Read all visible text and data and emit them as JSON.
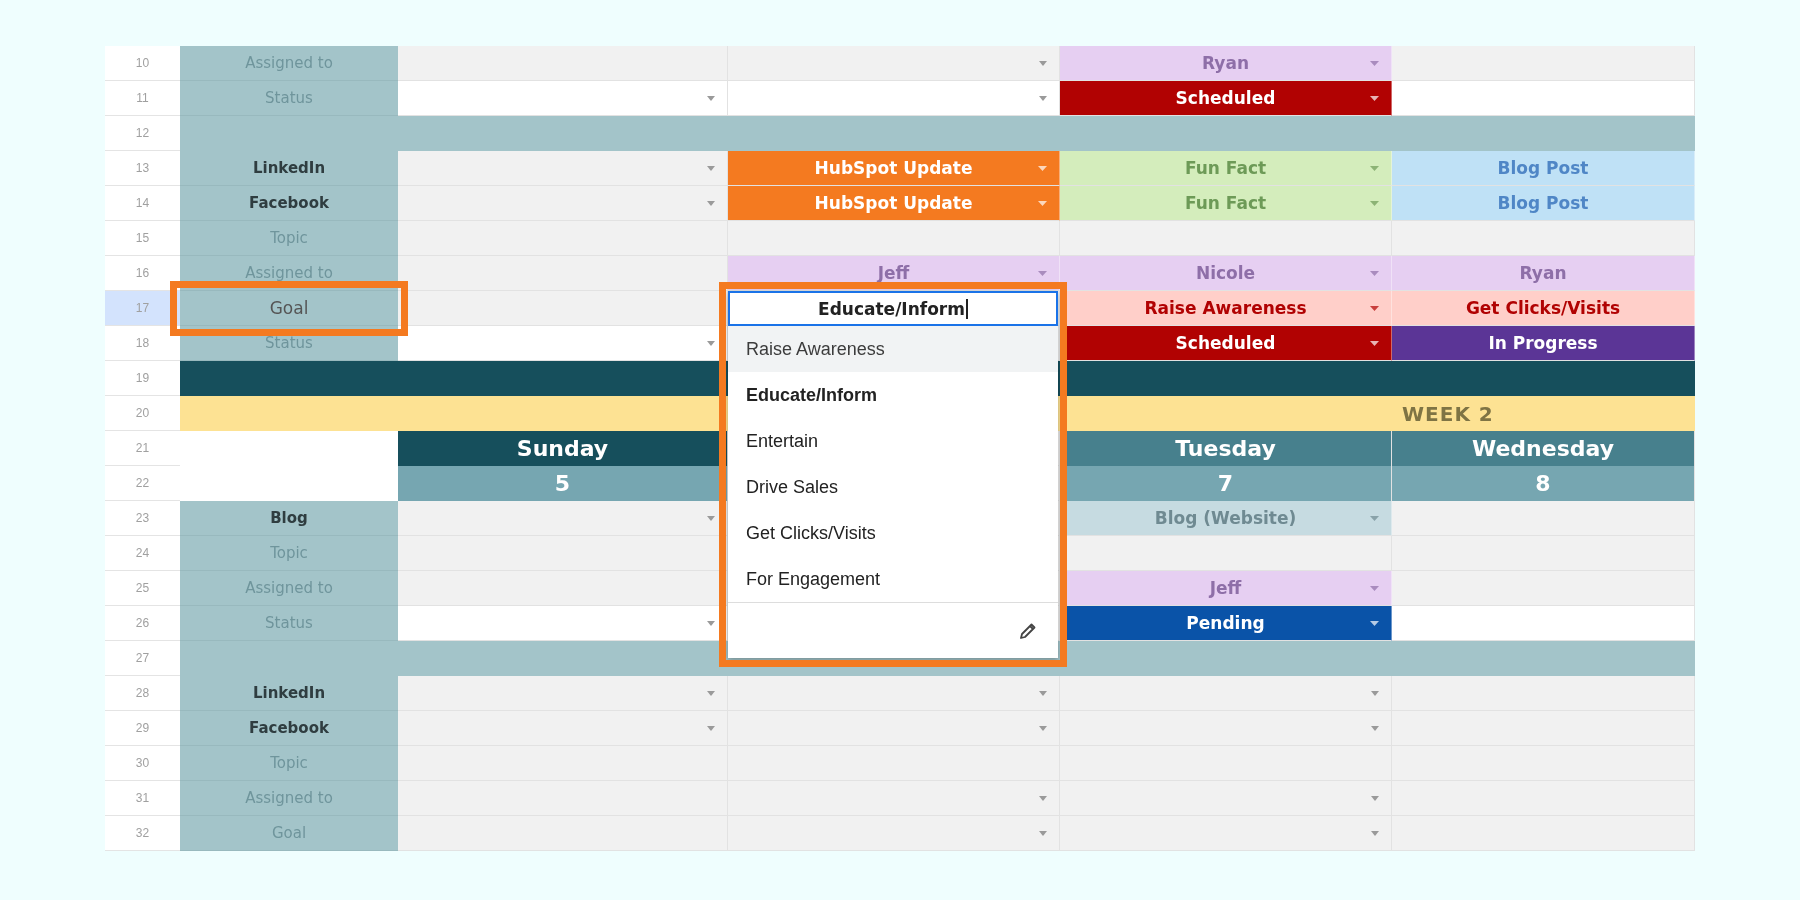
{
  "rows": [
    {
      "number": "10",
      "kind": "entry",
      "label": {
        "text": "Assigned to",
        "kind": "field"
      },
      "selected": false,
      "cells": [
        {
          "kind": "grey",
          "caret": false
        },
        {
          "kind": "grey",
          "caret": true
        },
        {
          "kind": "chip",
          "caret": true,
          "color": "#e6cff2",
          "label": {
            "text": "Ryan",
            "color": "#8e6fa8"
          }
        },
        {
          "kind": "grey",
          "caret": false
        }
      ]
    },
    {
      "number": "11",
      "kind": "entry",
      "label": {
        "text": "Status",
        "kind": "field"
      },
      "selected": false,
      "cells": [
        {
          "kind": "white",
          "caret": true
        },
        {
          "kind": "white",
          "caret": true
        },
        {
          "kind": "chip",
          "caret": true,
          "color": "#b10202",
          "label": {
            "text": "Scheduled",
            "color": "#ffffff"
          }
        },
        {
          "kind": "white",
          "caret": false
        }
      ]
    },
    {
      "number": "12",
      "kind": "divider"
    },
    {
      "number": "13",
      "kind": "entry",
      "label": {
        "text": "LinkedIn",
        "kind": "platform"
      },
      "selected": false,
      "cells": [
        {
          "kind": "grey",
          "caret": true
        },
        {
          "kind": "chip",
          "caret": true,
          "color": "#f47a20",
          "label": {
            "text": "HubSpot Update",
            "color": "#ffffff"
          }
        },
        {
          "kind": "chip",
          "caret": true,
          "color": "#d4edbc",
          "label": {
            "text": "Fun Fact",
            "color": "#6d9a57"
          }
        },
        {
          "kind": "chip",
          "caret": false,
          "color": "#bfe1f6",
          "label": {
            "text": "Blog Post",
            "color": "#4f86c6"
          }
        }
      ]
    },
    {
      "number": "14",
      "kind": "entry",
      "label": {
        "text": "Facebook",
        "kind": "platform"
      },
      "selected": false,
      "cells": [
        {
          "kind": "grey",
          "caret": true
        },
        {
          "kind": "chip",
          "caret": true,
          "color": "#f47a20",
          "label": {
            "text": "HubSpot Update",
            "color": "#ffffff"
          }
        },
        {
          "kind": "chip",
          "caret": true,
          "color": "#d4edbc",
          "label": {
            "text": "Fun Fact",
            "color": "#6d9a57"
          }
        },
        {
          "kind": "chip",
          "caret": false,
          "color": "#bfe1f6",
          "label": {
            "text": "Blog Post",
            "color": "#4f86c6"
          }
        }
      ]
    },
    {
      "number": "15",
      "kind": "entry",
      "label": {
        "text": "Topic",
        "kind": "field"
      },
      "selected": false,
      "cells": [
        {
          "kind": "grey",
          "caret": false
        },
        {
          "kind": "grey",
          "caret": false
        },
        {
          "kind": "grey",
          "caret": false
        },
        {
          "kind": "grey",
          "caret": false
        }
      ]
    },
    {
      "number": "16",
      "kind": "entry",
      "label": {
        "text": "Assigned to",
        "kind": "field"
      },
      "selected": false,
      "cells": [
        {
          "kind": "grey",
          "caret": false
        },
        {
          "kind": "chip",
          "caret": true,
          "color": "#e6cff2",
          "label": {
            "text": "Jeff",
            "color": "#8e6fa8"
          }
        },
        {
          "kind": "chip",
          "caret": true,
          "color": "#e6cff2",
          "label": {
            "text": "Nicole",
            "color": "#8e6fa8"
          }
        },
        {
          "kind": "chip",
          "caret": false,
          "color": "#e6cff2",
          "label": {
            "text": "Ryan",
            "color": "#8e6fa8"
          }
        }
      ]
    },
    {
      "number": "17",
      "kind": "entry",
      "label": {
        "text": "Goal",
        "kind": "field"
      },
      "selected": true,
      "cells": [
        {
          "kind": "grey",
          "caret": false
        },
        {
          "kind": "dropdown"
        },
        {
          "kind": "chip",
          "caret": true,
          "color": "#ffcfc9",
          "label": {
            "text": "Raise Awareness",
            "color": "#b10202"
          }
        },
        {
          "kind": "chip",
          "caret": false,
          "color": "#ffcfc9",
          "label": {
            "text": "Get Clicks/Visits",
            "color": "#b10202"
          }
        }
      ]
    },
    {
      "number": "18",
      "kind": "entry",
      "label": {
        "text": "Status",
        "kind": "field"
      },
      "selected": false,
      "cells": [
        {
          "kind": "white",
          "caret": true
        },
        {
          "kind": "covered"
        },
        {
          "kind": "chip",
          "caret": true,
          "color": "#b10202",
          "label": {
            "text": "Scheduled",
            "color": "#ffffff"
          }
        },
        {
          "kind": "chip",
          "caret": false,
          "color": "#5b3596",
          "label": {
            "text": "In Progress",
            "color": "#ffffff"
          }
        }
      ]
    },
    {
      "number": "19",
      "kind": "week_start"
    },
    {
      "number": "20",
      "kind": "week",
      "text": "WEEK 2"
    },
    {
      "number": "21",
      "kind": "day",
      "cells": [
        {
          "kind": "head",
          "text": "Sunday",
          "color": "#164f5c"
        },
        {
          "kind": "covered"
        },
        {
          "kind": "head",
          "text": "Tuesday",
          "color": "#47808d"
        },
        {
          "kind": "head",
          "text": "Wednesday",
          "color": "#47808d"
        }
      ]
    },
    {
      "number": "22",
      "kind": "day",
      "cells": [
        {
          "kind": "head",
          "text": "5",
          "color": "#76a6b1"
        },
        {
          "kind": "covered"
        },
        {
          "kind": "head",
          "text": "7",
          "color": "#76a6b1"
        },
        {
          "kind": "head",
          "text": "8",
          "color": "#76a6b1"
        }
      ]
    },
    {
      "number": "23",
      "kind": "entry",
      "label": {
        "text": "Blog",
        "kind": "platform"
      },
      "selected": false,
      "cells": [
        {
          "kind": "grey",
          "caret": true
        },
        {
          "kind": "covered"
        },
        {
          "kind": "chip",
          "caret": true,
          "color": "#c6dbe1",
          "label": {
            "text": "Blog (Website)",
            "color": "#6f8a92"
          }
        },
        {
          "kind": "grey",
          "caret": false
        }
      ]
    },
    {
      "number": "24",
      "kind": "entry",
      "label": {
        "text": "Topic",
        "kind": "field"
      },
      "selected": false,
      "cells": [
        {
          "kind": "grey",
          "caret": false
        },
        {
          "kind": "covered"
        },
        {
          "kind": "grey",
          "caret": false
        },
        {
          "kind": "grey",
          "caret": false
        }
      ]
    },
    {
      "number": "25",
      "kind": "entry",
      "label": {
        "text": "Assigned to",
        "kind": "field"
      },
      "selected": false,
      "cells": [
        {
          "kind": "grey",
          "caret": false
        },
        {
          "kind": "covered"
        },
        {
          "kind": "chip",
          "caret": true,
          "color": "#e6cff2",
          "label": {
            "text": "Jeff",
            "color": "#8e6fa8"
          }
        },
        {
          "kind": "grey",
          "caret": false
        }
      ]
    },
    {
      "number": "26",
      "kind": "entry",
      "label": {
        "text": "Status",
        "kind": "field"
      },
      "selected": false,
      "cells": [
        {
          "kind": "white",
          "caret": true
        },
        {
          "kind": "covered"
        },
        {
          "kind": "chip",
          "caret": true,
          "color": "#0a53a8",
          "label": {
            "text": "Pending",
            "color": "#ffffff"
          }
        },
        {
          "kind": "white",
          "caret": false
        }
      ]
    },
    {
      "number": "27",
      "kind": "divider"
    },
    {
      "number": "28",
      "kind": "entry",
      "label": {
        "text": "LinkedIn",
        "kind": "platform"
      },
      "selected": false,
      "cells": [
        {
          "kind": "grey",
          "caret": true
        },
        {
          "kind": "grey",
          "caret": true
        },
        {
          "kind": "grey",
          "caret": true
        },
        {
          "kind": "grey",
          "caret": false
        }
      ]
    },
    {
      "number": "29",
      "kind": "entry",
      "label": {
        "text": "Facebook",
        "kind": "platform"
      },
      "selected": false,
      "cells": [
        {
          "kind": "grey",
          "caret": true
        },
        {
          "kind": "grey",
          "caret": true
        },
        {
          "kind": "grey",
          "caret": true
        },
        {
          "kind": "grey",
          "caret": false
        }
      ]
    },
    {
      "number": "30",
      "kind": "entry",
      "label": {
        "text": "Topic",
        "kind": "field"
      },
      "selected": false,
      "cells": [
        {
          "kind": "grey",
          "caret": false
        },
        {
          "kind": "grey",
          "caret": false
        },
        {
          "kind": "grey",
          "caret": false
        },
        {
          "kind": "grey",
          "caret": false
        }
      ]
    },
    {
      "number": "31",
      "kind": "entry",
      "label": {
        "text": "Assigned to",
        "kind": "field"
      },
      "selected": false,
      "cells": [
        {
          "kind": "grey",
          "caret": false
        },
        {
          "kind": "grey",
          "caret": true
        },
        {
          "kind": "grey",
          "caret": true
        },
        {
          "kind": "grey",
          "caret": false
        }
      ]
    },
    {
      "number": "32",
      "kind": "entry",
      "label": {
        "text": "Goal",
        "kind": "field"
      },
      "selected": false,
      "cells": [
        {
          "kind": "grey",
          "caret": false
        },
        {
          "kind": "grey",
          "caret": true
        },
        {
          "kind": "grey",
          "caret": true
        },
        {
          "kind": "grey",
          "caret": false
        }
      ]
    }
  ],
  "dropdown": {
    "value": "Educate/Inform",
    "options": [
      {
        "label": "Raise Awareness",
        "hovered": true,
        "selected": false
      },
      {
        "label": "Educate/Inform",
        "hovered": false,
        "selected": true
      },
      {
        "label": "Entertain",
        "hovered": false,
        "selected": false
      },
      {
        "label": "Drive Sales",
        "hovered": false,
        "selected": false
      },
      {
        "label": "Get Clicks/Visits",
        "hovered": false,
        "selected": false
      },
      {
        "label": "For Engagement",
        "hovered": false,
        "selected": false
      }
    ]
  }
}
